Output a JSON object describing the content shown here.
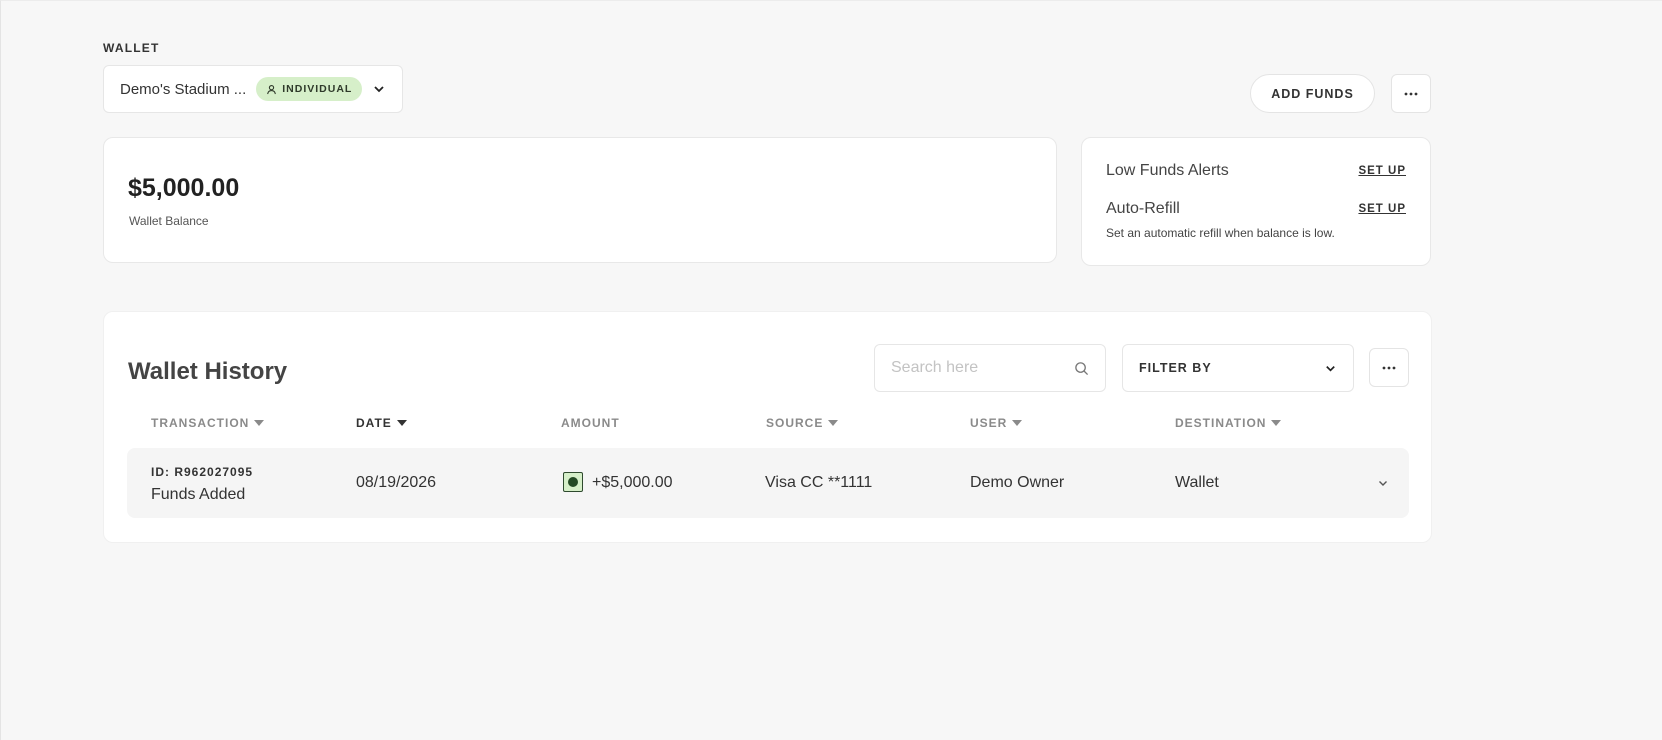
{
  "wallet": {
    "section_label": "WALLET",
    "selected_name": "Demo's Stadium ...",
    "badge": "INDIVIDUAL"
  },
  "actions": {
    "add_funds_label": "ADD FUNDS"
  },
  "balance": {
    "amount": "$5,000.00",
    "label": "Wallet Balance"
  },
  "alerts": {
    "low_funds": {
      "title": "Low Funds Alerts",
      "action": "SET UP"
    },
    "auto_refill": {
      "title": "Auto-Refill",
      "action": "SET UP",
      "description": "Set an automatic refill when balance is low."
    }
  },
  "history": {
    "title": "Wallet History",
    "search_placeholder": "Search here",
    "filter_label": "FILTER BY",
    "columns": [
      {
        "label": "TRANSACTION",
        "sortable": true,
        "active": false
      },
      {
        "label": "DATE",
        "sortable": true,
        "active": true
      },
      {
        "label": "AMOUNT",
        "sortable": false,
        "active": false
      },
      {
        "label": "SOURCE",
        "sortable": true,
        "active": false
      },
      {
        "label": "USER",
        "sortable": true,
        "active": false
      },
      {
        "label": "DESTINATION",
        "sortable": true,
        "active": false
      }
    ],
    "rows": [
      {
        "id": "ID: R962027095",
        "type": "Funds Added",
        "date": "08/19/2026",
        "amount": "+$5,000.00",
        "source": "Visa CC **1111",
        "user": "Demo Owner",
        "destination": "Wallet"
      }
    ]
  },
  "icons": {
    "badge": "user-icon",
    "wallet_dropdown": "chevron-down-icon",
    "more": "more-horizontal-icon",
    "search": "search-icon",
    "filter": "chevron-down-icon",
    "sort": "caret-down-icon",
    "amount": "deposit-icon",
    "row_expand": "chevron-down-icon"
  },
  "colors": {
    "badge_bg": "#d6efc9",
    "amount_icon": "#244a24",
    "page_bg": "#f7f7f7"
  }
}
